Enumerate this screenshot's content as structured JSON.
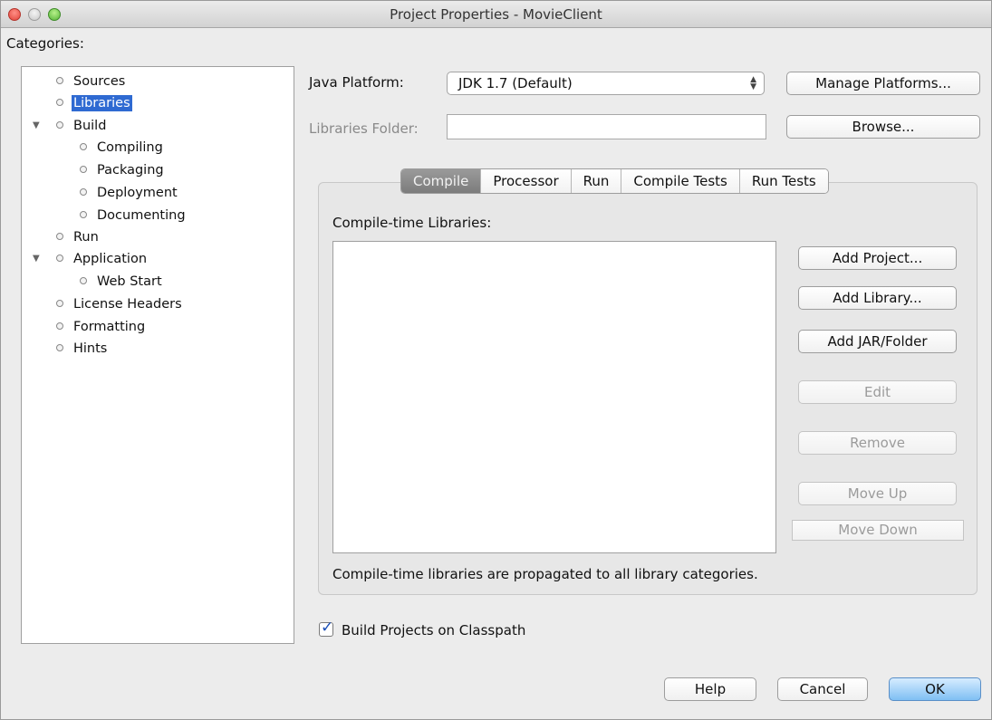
{
  "window": {
    "title": "Project Properties - MovieClient"
  },
  "categories": {
    "label": "Categories:",
    "items": [
      {
        "label": "Sources"
      },
      {
        "label": "Libraries"
      },
      {
        "label": "Build"
      },
      {
        "label": "Compiling"
      },
      {
        "label": "Packaging"
      },
      {
        "label": "Deployment"
      },
      {
        "label": "Documenting"
      },
      {
        "label": "Run"
      },
      {
        "label": "Application"
      },
      {
        "label": "Web Start"
      },
      {
        "label": "License Headers"
      },
      {
        "label": "Formatting"
      },
      {
        "label": "Hints"
      }
    ],
    "selected": "Libraries"
  },
  "platform": {
    "label": "Java Platform:",
    "value": "JDK 1.7 (Default)",
    "manage_button": "Manage Platforms..."
  },
  "libraries_folder": {
    "label": "Libraries Folder:",
    "value": "",
    "browse_button": "Browse..."
  },
  "tabs": [
    {
      "label": "Compile"
    },
    {
      "label": "Processor"
    },
    {
      "label": "Run"
    },
    {
      "label": "Compile Tests"
    },
    {
      "label": "Run Tests"
    }
  ],
  "compile": {
    "list_label": "Compile-time Libraries:",
    "buttons": {
      "add_project": "Add Project...",
      "add_library": "Add Library...",
      "add_jar": "Add JAR/Folder",
      "edit": "Edit",
      "remove": "Remove",
      "move_up": "Move Up",
      "move_down": "Move Down"
    },
    "note": "Compile-time libraries are propagated to all library categories."
  },
  "build_projects": {
    "label": "Build Projects on Classpath",
    "checked": true
  },
  "footer": {
    "help": "Help",
    "cancel": "Cancel",
    "ok": "OK"
  }
}
